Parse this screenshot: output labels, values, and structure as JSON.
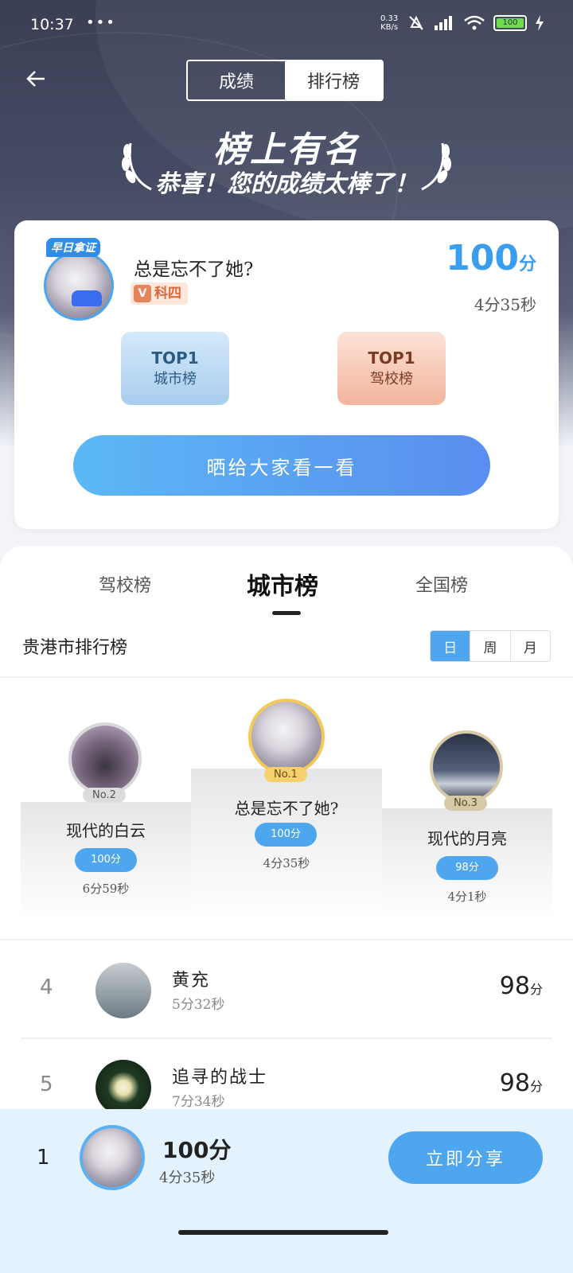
{
  "status_bar": {
    "time": "10:37",
    "dots": "•••",
    "net_speed_value": "0.33",
    "net_speed_unit": "KB/s",
    "battery": "100"
  },
  "header": {
    "back_icon": "arrow-left-icon",
    "segments": [
      "成绩",
      "排行榜"
    ],
    "active_segment": "排行榜"
  },
  "banner": {
    "title": "榜上有名",
    "subtitle": "恭喜！您的成绩太棒了！"
  },
  "result_card": {
    "avatar_badge": "早日拿证",
    "username": "总是忘不了她?",
    "tag_icon": "V",
    "tag": "科四",
    "score": "100",
    "score_unit": "分",
    "time": "4分35秒",
    "rank_badges": [
      {
        "top": "TOP1",
        "label": "城市榜"
      },
      {
        "top": "TOP1",
        "label": "驾校榜"
      }
    ],
    "share_button": "晒给大家看一看"
  },
  "leaderboard": {
    "tabs": [
      "驾校榜",
      "城市榜",
      "全国榜"
    ],
    "active_tab": "城市榜",
    "title": "贵港市排行榜",
    "periods": [
      "日",
      "周",
      "月"
    ],
    "active_period": "日",
    "podium": [
      {
        "place": "No.2",
        "name": "现代的白云",
        "score": "100分",
        "time": "6分59秒"
      },
      {
        "place": "No.1",
        "name": "总是忘不了她?",
        "score": "100分",
        "time": "4分35秒"
      },
      {
        "place": "No.3",
        "name": "现代的月亮",
        "score": "98分",
        "time": "4分1秒"
      }
    ],
    "rows": [
      {
        "rank": "4",
        "name": "黄充",
        "time": "5分32秒",
        "score": "98",
        "unit": "分"
      },
      {
        "rank": "5",
        "name": "追寻的战士",
        "time": "7分34秒",
        "score": "98",
        "unit": "分"
      }
    ]
  },
  "my_bar": {
    "rank": "1",
    "score": "100分",
    "time": "4分35秒",
    "button": "立即分享"
  },
  "colors": {
    "accent": "#4ea6ee",
    "header_bg": "#3a3f55",
    "gold": "#f4c95a"
  }
}
